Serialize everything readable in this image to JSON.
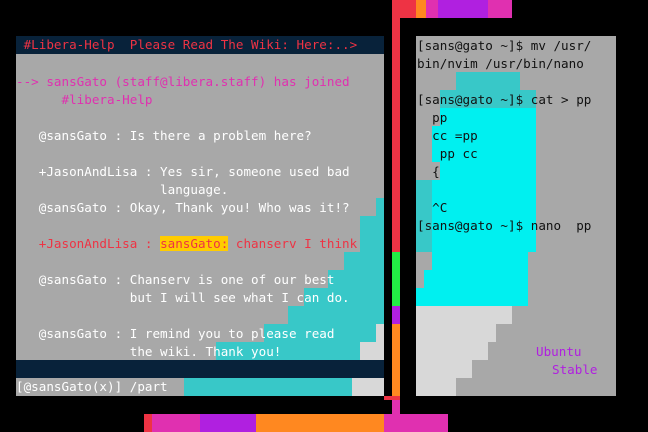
{
  "irc": {
    "title": " #Libera-Help  Please Read The Wiki: Here:..>",
    "join_line_1": "--> sansGato (staff@libera.staff) has joined",
    "join_line_2": "      #libera-Help",
    "msg1": "   @sansGato : Is there a problem here?",
    "msg2_line1": "   +JasonAndLisa : Yes sir, someone used bad",
    "msg2_line2": "                   language.",
    "msg3": "   @sansGato : Okay, Thank you! Who was it!?",
    "msg4_nick": "   +JasonAndLisa : ",
    "msg4_mention": "sansGato:",
    "msg4_rest": " chanserv I think",
    "msg5_line1": "   @sansGato : Chanserv is one of our best",
    "msg5_line2": "               but I will see what I can do.",
    "msg6_line1": "   @sansGato : I remind you to please read",
    "msg6_line2": "               the wiki. Thank you!",
    "input_prompt": "[@sansGato(x)] /part"
  },
  "terminal": {
    "lines": [
      "[sans@gato ~]$ mv /usr/",
      "bin/nvim /usr/bin/nano",
      "",
      "[sans@gato ~]$ cat > pp",
      "  pp",
      "  cc =pp",
      "   pp cc",
      "  {",
      "",
      "  ^C",
      "[sans@gato ~]$ nano  pp"
    ],
    "distro": "Ubuntu",
    "release": "Stable"
  },
  "colors": {
    "background": "#000000",
    "pane": "#a8a8a8",
    "titlebar": "#08223a",
    "cyan": "#00f0f0",
    "teal": "#38c8c8",
    "pink": "#e030b0",
    "red": "#ee3344",
    "orange": "#ff8820",
    "purple": "#b020e0",
    "green": "#22ee44"
  }
}
